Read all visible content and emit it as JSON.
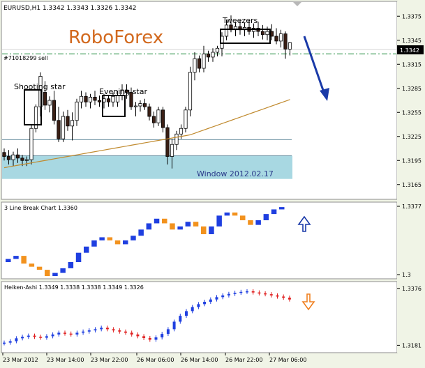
{
  "window": {
    "symbol_header": "EURUSD,H1  1.3342 1.3343 1.3326 1.3342",
    "brand": "RoboForex",
    "order_label": "#71018299 sell",
    "current_price_tag": "1.3342",
    "annotations": {
      "shooting_star": "Shooting star",
      "evening_star": "Evening star",
      "tweezers": "Tweezers",
      "window": "Window 2012.02.17"
    }
  },
  "colors": {
    "background": "#f0f4e6",
    "panel": "#ffffff",
    "bull_candle": "#ffffff",
    "bear_candle": "#3a1e14",
    "moving_average": "#c08a2e",
    "order_line": "#1f8a3a",
    "window_zone": "#a8d8e2",
    "trend_arrow": "#1a3aa8",
    "lb_up": "#1f3fe0",
    "lb_down": "#f2921e",
    "ha_up": "#1f3fe0",
    "ha_down": "#e02020",
    "signal_up_arrow": "#1a3aa8",
    "signal_down_arrow": "#f08020"
  },
  "time_axis": [
    "23 Mar 2012",
    "23 Mar 14:00",
    "23 Mar 22:00",
    "26 Mar 06:00",
    "26 Mar 14:00",
    "26 Mar 22:00",
    "27 Mar 06:00"
  ],
  "chart_data": [
    {
      "type": "candlestick",
      "title": "EURUSD,H1",
      "ylim": [
        1.315,
        1.339
      ],
      "yticks": [
        "1.3375",
        "1.3345",
        "1.3315",
        "1.3285",
        "1.3255",
        "1.3225",
        "1.3195",
        "1.3165"
      ],
      "series": [
        {
          "name": "",
          "values": [
            [
              1.3205,
              1.321,
              1.3195,
              1.32
            ],
            [
              1.32,
              1.3208,
              1.319,
              1.3196
            ],
            [
              1.3196,
              1.3206,
              1.3188,
              1.3202
            ],
            [
              1.3202,
              1.321,
              1.3192,
              1.3198
            ],
            [
              1.3198,
              1.3202,
              1.3188,
              1.3195
            ],
            [
              1.3195,
              1.32,
              1.3188,
              1.3196
            ],
            [
              1.3196,
              1.324,
              1.319,
              1.3235
            ],
            [
              1.3235,
              1.3265,
              1.323,
              1.3262
            ],
            [
              1.3262,
              1.3305,
              1.325,
              1.33
            ],
            [
              1.328,
              1.3294,
              1.3258,
              1.3264
            ],
            [
              1.3264,
              1.3275,
              1.3255,
              1.327
            ],
            [
              1.327,
              1.3282,
              1.324,
              1.3245
            ],
            [
              1.3245,
              1.3262,
              1.3218,
              1.3222
            ],
            [
              1.3222,
              1.3256,
              1.3218,
              1.325
            ],
            [
              1.325,
              1.3258,
              1.3232,
              1.3238
            ],
            [
              1.3238,
              1.3255,
              1.322,
              1.3245
            ],
            [
              1.3245,
              1.3272,
              1.3238,
              1.3268
            ],
            [
              1.3268,
              1.3282,
              1.326,
              1.3275
            ],
            [
              1.3275,
              1.328,
              1.3262,
              1.3268
            ],
            [
              1.3268,
              1.3278,
              1.326,
              1.3274
            ],
            [
              1.3274,
              1.3282,
              1.3264,
              1.327
            ],
            [
              1.327,
              1.3276,
              1.3262,
              1.3268
            ],
            [
              1.3268,
              1.3278,
              1.326,
              1.3272
            ],
            [
              1.3272,
              1.3276,
              1.3262,
              1.3268
            ],
            [
              1.3268,
              1.328,
              1.3262,
              1.3275
            ],
            [
              1.3268,
              1.3282,
              1.3262,
              1.3276
            ],
            [
              1.3276,
              1.329,
              1.327,
              1.3283
            ],
            [
              1.3283,
              1.329,
              1.3272,
              1.328
            ],
            [
              1.328,
              1.3286,
              1.3258,
              1.3262
            ],
            [
              1.3262,
              1.3268,
              1.325,
              1.3263
            ],
            [
              1.3263,
              1.327,
              1.3256,
              1.3266
            ],
            [
              1.3266,
              1.3272,
              1.3258,
              1.3262
            ],
            [
              1.3262,
              1.3266,
              1.3245,
              1.325
            ],
            [
              1.325,
              1.3256,
              1.3236,
              1.3242
            ],
            [
              1.3242,
              1.3262,
              1.3238,
              1.3258
            ],
            [
              1.3258,
              1.3262,
              1.323,
              1.3236
            ],
            [
              1.3236,
              1.324,
              1.319,
              1.32
            ],
            [
              1.32,
              1.3222,
              1.3185,
              1.3215
            ],
            [
              1.3215,
              1.3232,
              1.3208,
              1.3228
            ],
            [
              1.3228,
              1.324,
              1.3222,
              1.3235
            ],
            [
              1.3235,
              1.3262,
              1.323,
              1.3258
            ],
            [
              1.3258,
              1.3312,
              1.325,
              1.3305
            ],
            [
              1.3305,
              1.333,
              1.3295,
              1.3322
            ],
            [
              1.3322,
              1.3326,
              1.3305,
              1.331
            ],
            [
              1.331,
              1.3338,
              1.3305,
              1.3328
            ],
            [
              1.3328,
              1.3332,
              1.3318,
              1.3324
            ],
            [
              1.3324,
              1.3335,
              1.3318,
              1.333
            ],
            [
              1.333,
              1.3338,
              1.3325,
              1.3335
            ],
            [
              1.3335,
              1.3355,
              1.3325,
              1.335
            ],
            [
              1.335,
              1.337,
              1.3345,
              1.3364
            ],
            [
              1.3364,
              1.3376,
              1.3355,
              1.3358
            ],
            [
              1.3358,
              1.3368,
              1.335,
              1.3362
            ],
            [
              1.3362,
              1.337,
              1.3352,
              1.3358
            ],
            [
              1.3358,
              1.3367,
              1.335,
              1.3361
            ],
            [
              1.3361,
              1.337,
              1.3352,
              1.3356
            ],
            [
              1.3356,
              1.3366,
              1.3348,
              1.336
            ],
            [
              1.336,
              1.3368,
              1.335,
              1.3356
            ],
            [
              1.3356,
              1.3364,
              1.3346,
              1.3352
            ],
            [
              1.3352,
              1.3362,
              1.3345,
              1.3356
            ],
            [
              1.3356,
              1.3365,
              1.3345,
              1.335
            ],
            [
              1.335,
              1.336,
              1.334,
              1.3344
            ],
            [
              1.3344,
              1.3358,
              1.3336,
              1.3353
            ],
            [
              1.3353,
              1.3356,
              1.3322,
              1.3334
            ],
            [
              1.3334,
              1.3343,
              1.3326,
              1.3342
            ]
          ]
        },
        {
          "name": "",
          "values": [
            1.3186,
            1.3187,
            1.3188,
            1.3189,
            1.319,
            1.3191,
            1.3192,
            1.3193,
            1.3194,
            1.3195,
            1.3196,
            1.3197,
            1.3198,
            1.3199,
            1.32,
            1.3201,
            1.3202,
            1.3203,
            1.3204,
            1.3205,
            1.3206,
            1.3207,
            1.3208,
            1.3209,
            1.321,
            1.3211,
            1.3212,
            1.3213,
            1.3214,
            1.3215,
            1.3216,
            1.3217,
            1.3218,
            1.3219,
            1.322,
            1.3221,
            1.3222,
            1.3223,
            1.3224,
            1.3225,
            1.3226,
            1.3227,
            1.3229,
            1.3231,
            1.3233,
            1.3235,
            1.3237,
            1.3239,
            1.3241,
            1.3243,
            1.3245,
            1.3247,
            1.3249,
            1.3251,
            1.3253,
            1.3255,
            1.3257,
            1.3259,
            1.3261,
            1.3263,
            1.3265,
            1.3267,
            1.3269,
            1.3271
          ]
        }
      ],
      "horizontal_levels": [
        1.3328,
        1.3221,
        1.3201
      ],
      "zone": [
        1.3172,
        1.3201
      ]
    },
    {
      "type": "bar",
      "title": "3 Line Break Chart 1.3360",
      "yticks": [
        "1.3377",
        "1.3"
      ],
      "ylim": [
        1.25,
        1.34
      ],
      "series": [
        {
          "name": "",
          "values": [
            [
              1.268,
              1.272,
              1
            ],
            [
              1.272,
              1.276,
              1
            ],
            [
              1.276,
              1.266,
              0
            ],
            [
              1.266,
              1.262,
              0
            ],
            [
              1.262,
              1.258,
              0
            ],
            [
              1.258,
              1.25,
              0
            ],
            [
              1.25,
              1.254,
              1
            ],
            [
              1.254,
              1.26,
              1
            ],
            [
              1.26,
              1.268,
              1
            ],
            [
              1.268,
              1.28,
              1
            ],
            [
              1.28,
              1.288,
              1
            ],
            [
              1.288,
              1.296,
              1
            ],
            [
              1.296,
              1.3,
              1
            ],
            [
              1.3,
              1.296,
              0
            ],
            [
              1.296,
              1.291,
              0
            ],
            [
              1.291,
              1.296,
              1
            ],
            [
              1.296,
              1.302,
              1
            ],
            [
              1.302,
              1.31,
              1
            ],
            [
              1.31,
              1.318,
              1
            ],
            [
              1.318,
              1.324,
              1
            ],
            [
              1.324,
              1.318,
              0
            ],
            [
              1.318,
              1.31,
              0
            ],
            [
              1.31,
              1.314,
              1
            ],
            [
              1.314,
              1.32,
              1
            ],
            [
              1.32,
              1.314,
              0
            ],
            [
              1.314,
              1.304,
              0
            ],
            [
              1.304,
              1.314,
              1
            ],
            [
              1.314,
              1.328,
              1
            ],
            [
              1.328,
              1.332,
              1
            ],
            [
              1.332,
              1.328,
              0
            ],
            [
              1.328,
              1.322,
              0
            ],
            [
              1.322,
              1.316,
              0
            ],
            [
              1.316,
              1.322,
              1
            ],
            [
              1.322,
              1.33,
              1
            ],
            [
              1.33,
              1.336,
              1
            ],
            [
              1.336,
              1.339,
              1
            ]
          ]
        }
      ]
    },
    {
      "type": "bar",
      "title": "Heiken-Ashi 1.3349 1.3338 1.3338 1.3349 1.3326",
      "yticks": [
        "1.3376",
        "1.3181"
      ],
      "ylim": [
        1.317,
        1.3385
      ],
      "series": [
        {
          "name": "",
          "values": [
            [
              1.3188,
              1.319,
              1
            ],
            [
              1.319,
              1.3195,
              1
            ],
            [
              1.3195,
              1.3205,
              1
            ],
            [
              1.3205,
              1.321,
              1
            ],
            [
              1.321,
              1.3214,
              1
            ],
            [
              1.3214,
              1.321,
              0
            ],
            [
              1.321,
              1.3207,
              0
            ],
            [
              1.3207,
              1.3212,
              1
            ],
            [
              1.3212,
              1.3218,
              1
            ],
            [
              1.3218,
              1.3224,
              1
            ],
            [
              1.3224,
              1.3221,
              0
            ],
            [
              1.3221,
              1.3218,
              0
            ],
            [
              1.3218,
              1.3224,
              1
            ],
            [
              1.3224,
              1.3228,
              1
            ],
            [
              1.3228,
              1.3232,
              1
            ],
            [
              1.3232,
              1.3236,
              1
            ],
            [
              1.3236,
              1.3241,
              1
            ],
            [
              1.3241,
              1.3236,
              0
            ],
            [
              1.3236,
              1.3232,
              0
            ],
            [
              1.3232,
              1.3228,
              0
            ],
            [
              1.3228,
              1.3224,
              0
            ],
            [
              1.3224,
              1.3218,
              0
            ],
            [
              1.3218,
              1.3212,
              0
            ],
            [
              1.3212,
              1.3206,
              0
            ],
            [
              1.3206,
              1.32,
              0
            ],
            [
              1.32,
              1.3208,
              1
            ],
            [
              1.3208,
              1.322,
              1
            ],
            [
              1.322,
              1.3236,
              1
            ],
            [
              1.3236,
              1.3262,
              1
            ],
            [
              1.3262,
              1.3282,
              1
            ],
            [
              1.3282,
              1.3298,
              1
            ],
            [
              1.3298,
              1.3312,
              1
            ],
            [
              1.3312,
              1.3322,
              1
            ],
            [
              1.3322,
              1.333,
              1
            ],
            [
              1.333,
              1.3338,
              1
            ],
            [
              1.3338,
              1.3346,
              1
            ],
            [
              1.3346,
              1.3352,
              1
            ],
            [
              1.3352,
              1.3357,
              1
            ],
            [
              1.3357,
              1.3361,
              1
            ],
            [
              1.3361,
              1.3364,
              1
            ],
            [
              1.3364,
              1.3366,
              1
            ],
            [
              1.3366,
              1.3362,
              0
            ],
            [
              1.3362,
              1.3359,
              0
            ],
            [
              1.3359,
              1.3356,
              0
            ],
            [
              1.3356,
              1.3352,
              0
            ],
            [
              1.3352,
              1.3348,
              0
            ],
            [
              1.3348,
              1.3344,
              0
            ],
            [
              1.3344,
              1.3338,
              0
            ]
          ]
        }
      ]
    }
  ]
}
